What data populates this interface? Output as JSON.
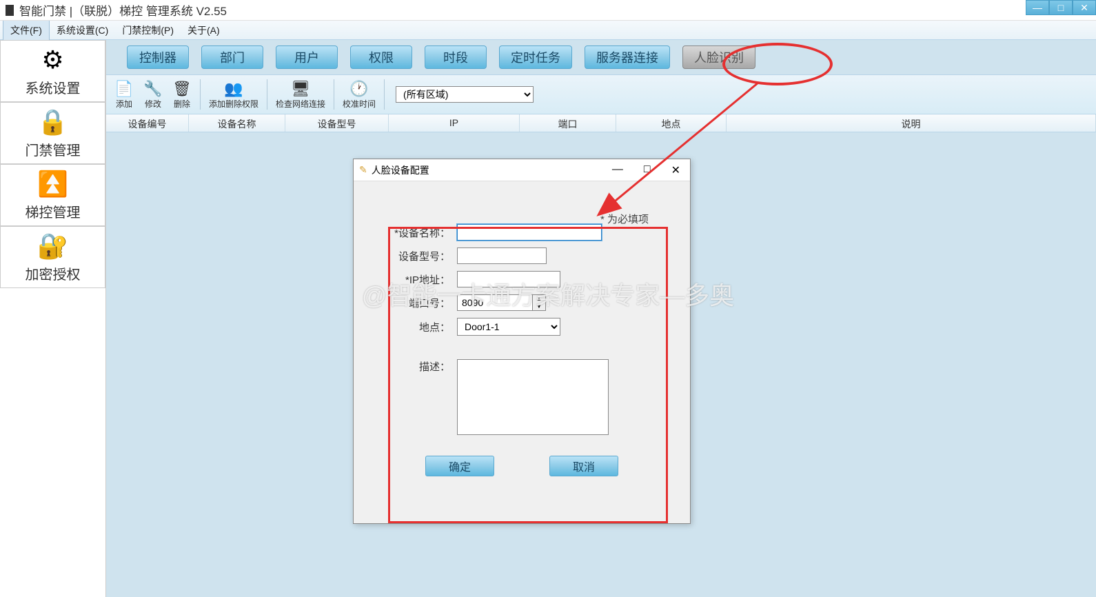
{
  "app": {
    "title": "智能门禁 |（联脱）梯控 管理系统  V2.55"
  },
  "menubar": {
    "file": "文件(F)",
    "system": "系统设置(C)",
    "access": "门禁控制(P)",
    "about": "关于(A)"
  },
  "sidebar": {
    "system_settings": "系统设置",
    "access_mgmt": "门禁管理",
    "elevator_mgmt": "梯控管理",
    "license": "加密授权"
  },
  "tabs": {
    "controller": "控制器",
    "department": "部门",
    "user": "用户",
    "permission": "权限",
    "period": "时段",
    "scheduled": "定时任务",
    "server": "服务器连接",
    "face": "人脸识别"
  },
  "toolbar": {
    "add": "添加",
    "edit": "修改",
    "delete": "删除",
    "add_del_perm": "添加删除权限",
    "check_net": "检查网络连接",
    "sync_time": "校准时间",
    "region_selected": "(所有区域)"
  },
  "table": {
    "col_device_no": "设备编号",
    "col_device_name": "设备名称",
    "col_device_model": "设备型号",
    "col_ip": "IP",
    "col_port": "端口",
    "col_location": "地点",
    "col_desc": "说明"
  },
  "dialog": {
    "title": "人脸设备配置",
    "required_note": "* 为必填项",
    "device_name_label": "*设备名称：",
    "device_model_label": "设备型号：",
    "ip_label": "*IP地址：",
    "port_label": "端口号：",
    "port_value": "8090",
    "location_label": "地点：",
    "location_value": "Door1-1",
    "desc_label": "描述：",
    "ok": "确定",
    "cancel": "取消"
  },
  "watermark": "@智能一卡通方案解决专家—多奥"
}
